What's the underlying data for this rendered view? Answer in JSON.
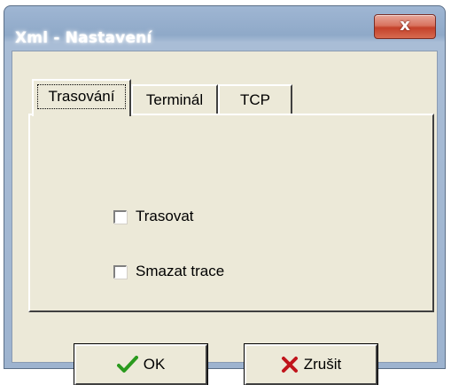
{
  "window": {
    "title": "Xml - Nastavení",
    "close_glyph": "x"
  },
  "tabs": [
    {
      "label": "Trasování"
    },
    {
      "label": "Terminál"
    },
    {
      "label": "TCP"
    }
  ],
  "options": [
    {
      "label": "Trasovat",
      "checked": false
    },
    {
      "label": "Smazat trace",
      "checked": false
    }
  ],
  "buttons": {
    "ok": {
      "label": "OK",
      "icon": "checkmark-icon",
      "icon_color": "#2a9a1e"
    },
    "cancel": {
      "label": "Zrušit",
      "icon": "cross-icon",
      "icon_color": "#c0141b"
    }
  }
}
